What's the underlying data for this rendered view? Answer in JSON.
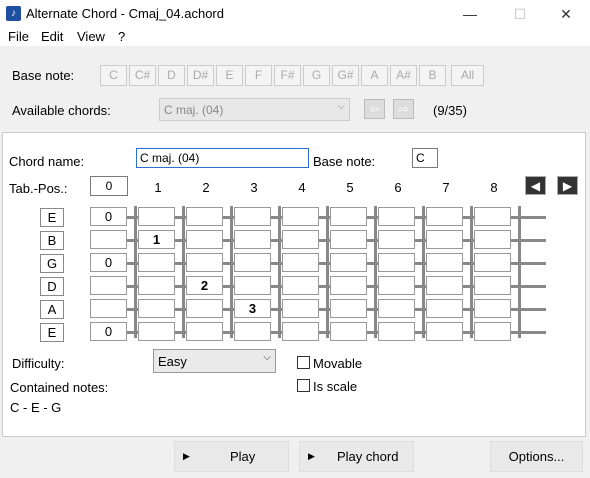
{
  "window": {
    "title": "Alternate Chord - Cmaj_04.achord",
    "app_icon": "music-note-icon",
    "minimize": "—",
    "maximize": "☐",
    "close": "✕"
  },
  "menu": [
    "File",
    "Edit",
    "View",
    "?"
  ],
  "base_note_row": {
    "label": "Base note:",
    "notes": [
      "C",
      "C#",
      "D",
      "D#",
      "E",
      "F",
      "F#",
      "G",
      "G#",
      "A",
      "A#",
      "B"
    ],
    "all_label": "All"
  },
  "available_chords": {
    "label": "Available chords:",
    "selected": "C maj. (04)",
    "counter": "(9/35)",
    "prev_icon": "arrow-left-icon",
    "next_icon": "arrow-right-icon"
  },
  "chord": {
    "name_label": "Chord name:",
    "name_value": "C maj. (04)",
    "base_note_label": "Base note:",
    "base_note_value": "C",
    "tabpos_label": "Tab.-Pos.:",
    "tabpos_value": "0",
    "fret_numbers": [
      "1",
      "2",
      "3",
      "4",
      "5",
      "6",
      "7",
      "8"
    ]
  },
  "fretboard": {
    "strings": [
      "E",
      "B",
      "G",
      "D",
      "A",
      "E"
    ],
    "cells": [
      [
        "0",
        "",
        "",
        "",
        "",
        "",
        "",
        "",
        ""
      ],
      [
        "",
        "1",
        "",
        "",
        "",
        "",
        "",
        "",
        ""
      ],
      [
        "0",
        "",
        "",
        "",
        "",
        "",
        "",
        "",
        ""
      ],
      [
        "",
        "",
        "2",
        "",
        "",
        "",
        "",
        "",
        ""
      ],
      [
        "",
        "",
        "",
        "3",
        "",
        "",
        "",
        "",
        ""
      ],
      [
        "0",
        "",
        "",
        "",
        "",
        "",
        "",
        "",
        ""
      ]
    ]
  },
  "difficulty": {
    "label": "Difficulty:",
    "value": "Easy"
  },
  "options": {
    "movable_label": "Movable",
    "is_scale_label": "Is scale"
  },
  "contained_notes": {
    "label": "Contained notes:",
    "value": "C - E - G"
  },
  "bottom_buttons": {
    "play": "Play",
    "play_chord": "Play chord",
    "options": "Options..."
  },
  "colors": {
    "focus_border": "#2f6ed3",
    "nav_button": "#333333",
    "fret_line": "#888888"
  }
}
